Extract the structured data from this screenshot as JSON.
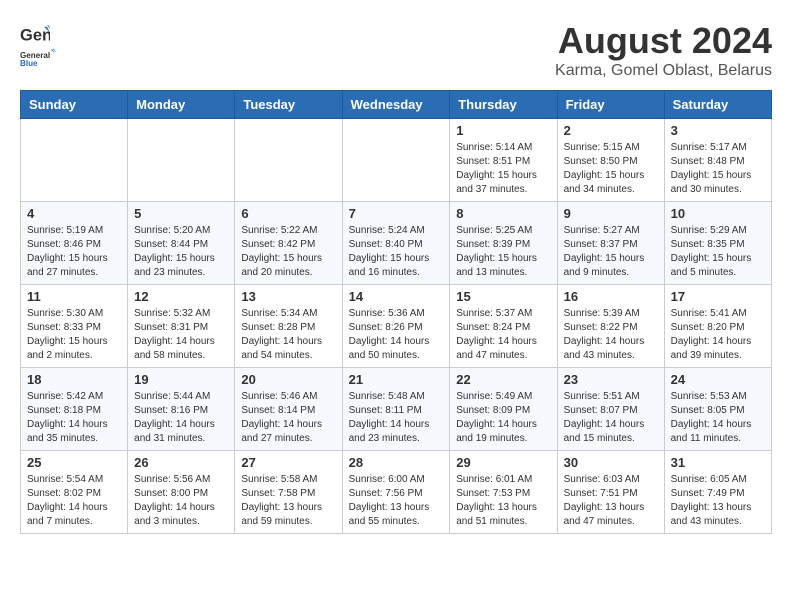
{
  "logo": {
    "general": "General",
    "blue": "Blue"
  },
  "header": {
    "month_year": "August 2024",
    "location": "Karma, Gomel Oblast, Belarus"
  },
  "weekdays": [
    "Sunday",
    "Monday",
    "Tuesday",
    "Wednesday",
    "Thursday",
    "Friday",
    "Saturday"
  ],
  "weeks": [
    [
      {
        "day": "",
        "info": ""
      },
      {
        "day": "",
        "info": ""
      },
      {
        "day": "",
        "info": ""
      },
      {
        "day": "",
        "info": ""
      },
      {
        "day": "1",
        "info": "Sunrise: 5:14 AM\nSunset: 8:51 PM\nDaylight: 15 hours\nand 37 minutes."
      },
      {
        "day": "2",
        "info": "Sunrise: 5:15 AM\nSunset: 8:50 PM\nDaylight: 15 hours\nand 34 minutes."
      },
      {
        "day": "3",
        "info": "Sunrise: 5:17 AM\nSunset: 8:48 PM\nDaylight: 15 hours\nand 30 minutes."
      }
    ],
    [
      {
        "day": "4",
        "info": "Sunrise: 5:19 AM\nSunset: 8:46 PM\nDaylight: 15 hours\nand 27 minutes."
      },
      {
        "day": "5",
        "info": "Sunrise: 5:20 AM\nSunset: 8:44 PM\nDaylight: 15 hours\nand 23 minutes."
      },
      {
        "day": "6",
        "info": "Sunrise: 5:22 AM\nSunset: 8:42 PM\nDaylight: 15 hours\nand 20 minutes."
      },
      {
        "day": "7",
        "info": "Sunrise: 5:24 AM\nSunset: 8:40 PM\nDaylight: 15 hours\nand 16 minutes."
      },
      {
        "day": "8",
        "info": "Sunrise: 5:25 AM\nSunset: 8:39 PM\nDaylight: 15 hours\nand 13 minutes."
      },
      {
        "day": "9",
        "info": "Sunrise: 5:27 AM\nSunset: 8:37 PM\nDaylight: 15 hours\nand 9 minutes."
      },
      {
        "day": "10",
        "info": "Sunrise: 5:29 AM\nSunset: 8:35 PM\nDaylight: 15 hours\nand 5 minutes."
      }
    ],
    [
      {
        "day": "11",
        "info": "Sunrise: 5:30 AM\nSunset: 8:33 PM\nDaylight: 15 hours\nand 2 minutes."
      },
      {
        "day": "12",
        "info": "Sunrise: 5:32 AM\nSunset: 8:31 PM\nDaylight: 14 hours\nand 58 minutes."
      },
      {
        "day": "13",
        "info": "Sunrise: 5:34 AM\nSunset: 8:28 PM\nDaylight: 14 hours\nand 54 minutes."
      },
      {
        "day": "14",
        "info": "Sunrise: 5:36 AM\nSunset: 8:26 PM\nDaylight: 14 hours\nand 50 minutes."
      },
      {
        "day": "15",
        "info": "Sunrise: 5:37 AM\nSunset: 8:24 PM\nDaylight: 14 hours\nand 47 minutes."
      },
      {
        "day": "16",
        "info": "Sunrise: 5:39 AM\nSunset: 8:22 PM\nDaylight: 14 hours\nand 43 minutes."
      },
      {
        "day": "17",
        "info": "Sunrise: 5:41 AM\nSunset: 8:20 PM\nDaylight: 14 hours\nand 39 minutes."
      }
    ],
    [
      {
        "day": "18",
        "info": "Sunrise: 5:42 AM\nSunset: 8:18 PM\nDaylight: 14 hours\nand 35 minutes."
      },
      {
        "day": "19",
        "info": "Sunrise: 5:44 AM\nSunset: 8:16 PM\nDaylight: 14 hours\nand 31 minutes."
      },
      {
        "day": "20",
        "info": "Sunrise: 5:46 AM\nSunset: 8:14 PM\nDaylight: 14 hours\nand 27 minutes."
      },
      {
        "day": "21",
        "info": "Sunrise: 5:48 AM\nSunset: 8:11 PM\nDaylight: 14 hours\nand 23 minutes."
      },
      {
        "day": "22",
        "info": "Sunrise: 5:49 AM\nSunset: 8:09 PM\nDaylight: 14 hours\nand 19 minutes."
      },
      {
        "day": "23",
        "info": "Sunrise: 5:51 AM\nSunset: 8:07 PM\nDaylight: 14 hours\nand 15 minutes."
      },
      {
        "day": "24",
        "info": "Sunrise: 5:53 AM\nSunset: 8:05 PM\nDaylight: 14 hours\nand 11 minutes."
      }
    ],
    [
      {
        "day": "25",
        "info": "Sunrise: 5:54 AM\nSunset: 8:02 PM\nDaylight: 14 hours\nand 7 minutes."
      },
      {
        "day": "26",
        "info": "Sunrise: 5:56 AM\nSunset: 8:00 PM\nDaylight: 14 hours\nand 3 minutes."
      },
      {
        "day": "27",
        "info": "Sunrise: 5:58 AM\nSunset: 7:58 PM\nDaylight: 13 hours\nand 59 minutes."
      },
      {
        "day": "28",
        "info": "Sunrise: 6:00 AM\nSunset: 7:56 PM\nDaylight: 13 hours\nand 55 minutes."
      },
      {
        "day": "29",
        "info": "Sunrise: 6:01 AM\nSunset: 7:53 PM\nDaylight: 13 hours\nand 51 minutes."
      },
      {
        "day": "30",
        "info": "Sunrise: 6:03 AM\nSunset: 7:51 PM\nDaylight: 13 hours\nand 47 minutes."
      },
      {
        "day": "31",
        "info": "Sunrise: 6:05 AM\nSunset: 7:49 PM\nDaylight: 13 hours\nand 43 minutes."
      }
    ]
  ]
}
